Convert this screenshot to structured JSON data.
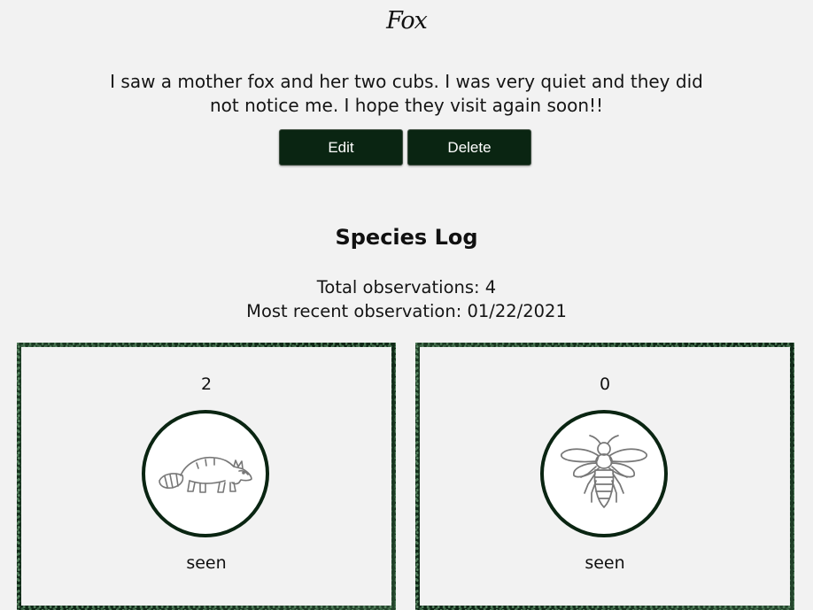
{
  "observation": {
    "title": "Fox",
    "note": "I saw a mother fox and her two cubs. I was very quiet and they did not notice me. I hope they visit again soon!!",
    "edit_label": "Edit",
    "delete_label": "Delete"
  },
  "species_log": {
    "heading": "Species Log",
    "total_observations": "Total observations: 4",
    "most_recent": "Most recent observation: 01/22/2021",
    "cards": [
      {
        "count": "2",
        "icon": "raccoon-icon",
        "status": "seen"
      },
      {
        "count": "0",
        "icon": "bee-icon",
        "status": "seen"
      }
    ]
  },
  "colors": {
    "background": "#f2f2f2",
    "button": "#0a2512",
    "badge_border": "#0a2512",
    "card_frame": "#15301c",
    "icon_stroke": "#777777"
  }
}
